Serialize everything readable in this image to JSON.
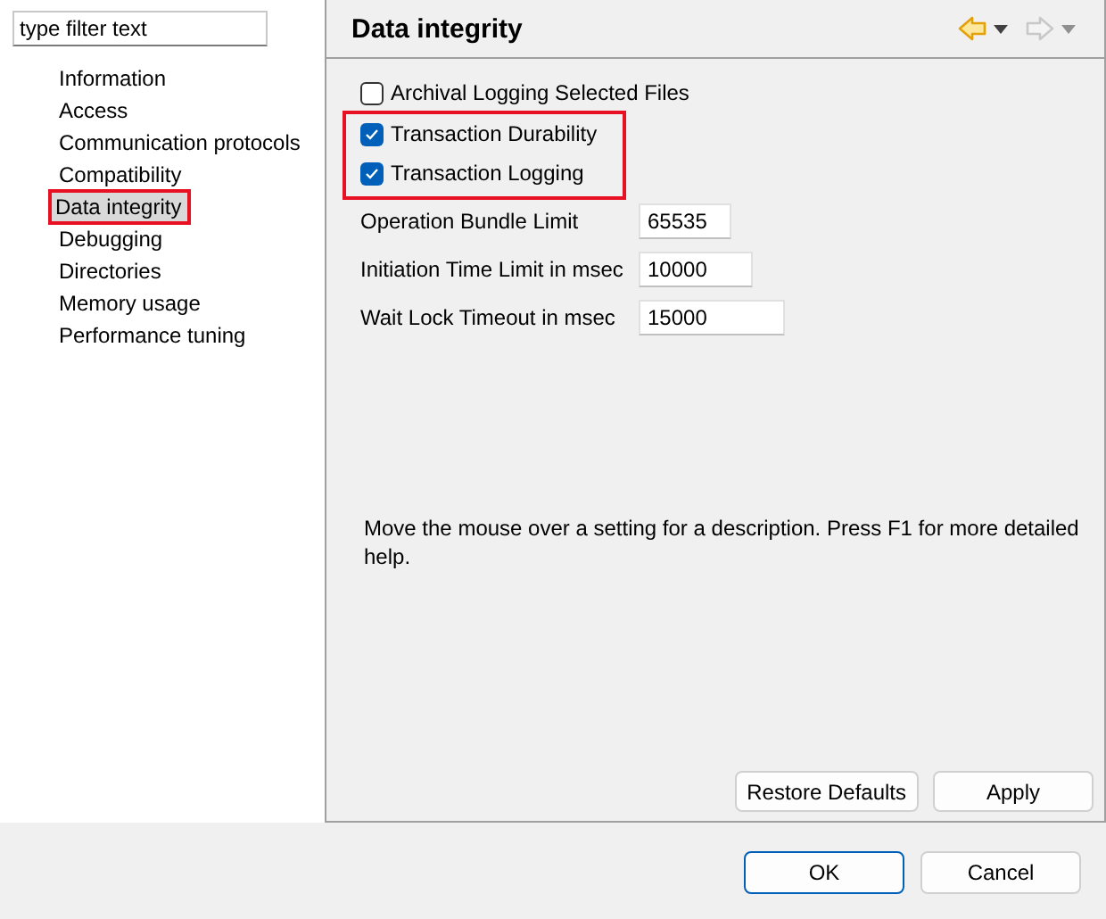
{
  "filter": {
    "placeholder": "type filter text"
  },
  "sidebar": {
    "items": [
      {
        "label": "Information",
        "selected": false,
        "highlighted": false
      },
      {
        "label": "Access",
        "selected": false,
        "highlighted": false
      },
      {
        "label": "Communication protocols",
        "selected": false,
        "highlighted": false
      },
      {
        "label": "Compatibility",
        "selected": false,
        "highlighted": false
      },
      {
        "label": "Data integrity",
        "selected": true,
        "highlighted": true
      },
      {
        "label": "Debugging",
        "selected": false,
        "highlighted": false
      },
      {
        "label": "Directories",
        "selected": false,
        "highlighted": false
      },
      {
        "label": "Memory usage",
        "selected": false,
        "highlighted": false
      },
      {
        "label": "Performance tuning",
        "selected": false,
        "highlighted": false
      }
    ]
  },
  "page": {
    "title": "Data integrity",
    "nav": [
      {
        "kind": "back",
        "disabled": false
      },
      {
        "kind": "forward",
        "disabled": true
      }
    ],
    "checkboxes": [
      {
        "label": "Archival Logging Selected Files",
        "checked": false,
        "highlighted": false
      },
      {
        "label": "Transaction Durability",
        "checked": true,
        "highlighted": true
      },
      {
        "label": "Transaction Logging",
        "checked": true,
        "highlighted": true
      }
    ],
    "fields": [
      {
        "label": "Operation Bundle Limit",
        "value": "65535"
      },
      {
        "label": "Initiation Time Limit in msec",
        "value": "10000"
      },
      {
        "label": "Wait Lock Timeout in msec",
        "value": "15000"
      }
    ],
    "description": "Move the mouse over a setting for a description. Press F1 for more detailed help.",
    "buttons": [
      "Restore Defaults",
      "Apply"
    ]
  },
  "dialog_buttons": [
    {
      "label": "OK",
      "default": true
    },
    {
      "label": "Cancel",
      "default": false
    }
  ]
}
